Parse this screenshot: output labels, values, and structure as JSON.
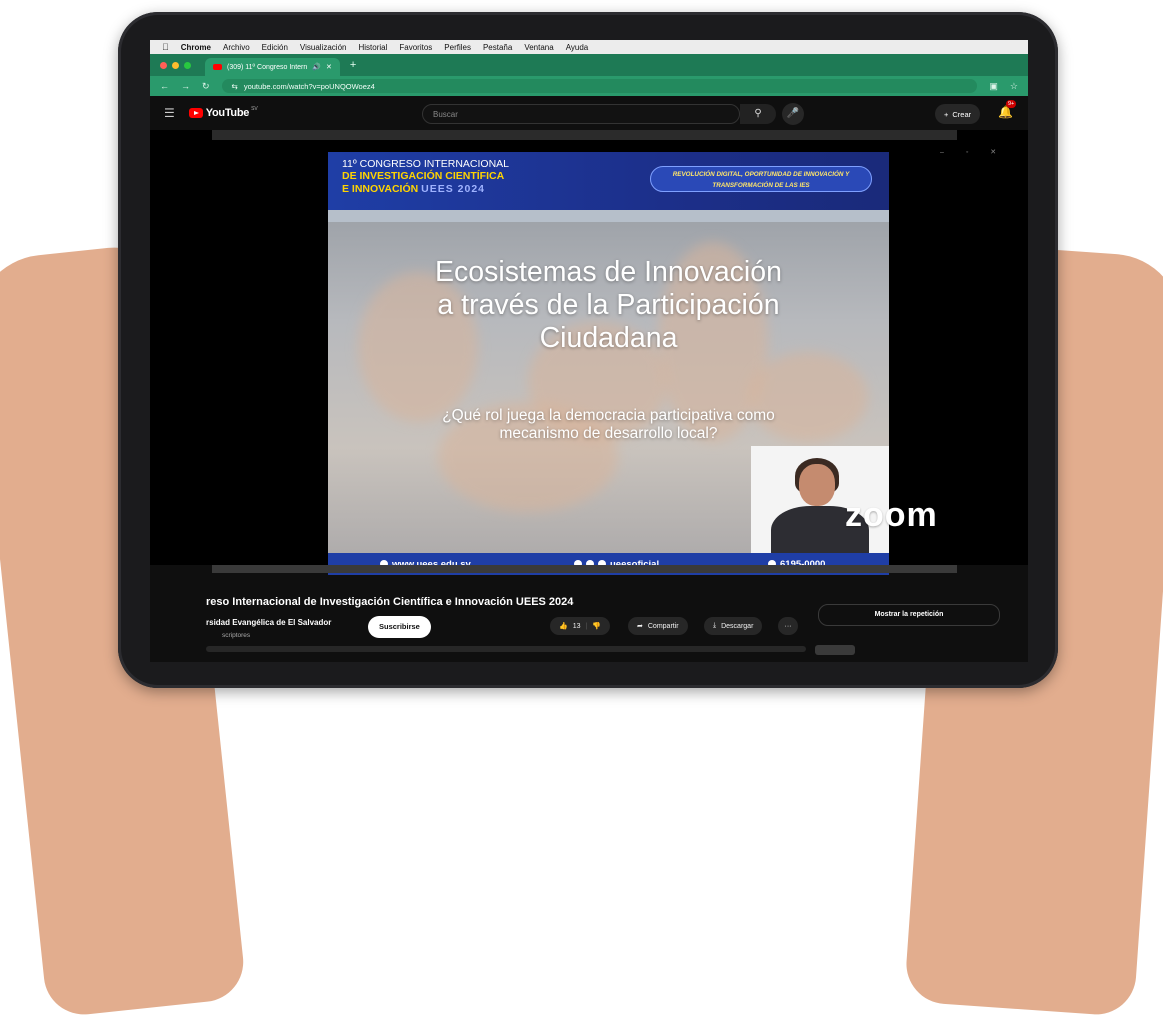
{
  "menubar": {
    "apple": "",
    "items": [
      "Chrome",
      "Archivo",
      "Edición",
      "Visualización",
      "Historial",
      "Favoritos",
      "Perfiles",
      "Pestaña",
      "Ventana",
      "Ayuda"
    ]
  },
  "browser": {
    "tab_title": "(309) 11º Congreso Intern",
    "new_tab": "+",
    "url": "youtube.com/watch?v=poUNQOWoez4"
  },
  "youtube": {
    "logo": "YouTube",
    "country": "SV",
    "search_placeholder": "Buscar",
    "create_label": "Crear",
    "notifications_badge": "9+"
  },
  "video": {
    "banner_line1": "11º CONGRESO INTERNACIONAL",
    "banner_line2": "DE INVESTIGACIÓN CIENTÍFICA",
    "banner_line3": "E INNOVACIÓN",
    "banner_line3_suffix": "UEES 2024",
    "banner_right": "REVOLUCIÓN DIGITAL, OPORTUNIDAD DE INNOVACIÓN Y TRANSFORMACIÓN DE LAS IES",
    "slide_title_1": "Ecosistemas de Innovación",
    "slide_title_2": "a través de la Participación",
    "slide_title_3": "Ciudadana",
    "slide_subtitle_1": "¿Qué rol juega la democracia participativa como",
    "slide_subtitle_2": "mecanismo de desarrollo local?",
    "footer_web": "www.uees.edu.sv",
    "footer_social": "ueesoficial",
    "footer_phone": "6195-0000",
    "zoom_watermark": "zoom"
  },
  "details": {
    "title": "reso Internacional de Investigación Científica e Innovación UEES 2024",
    "channel": "rsidad Evangélica de El Salvador",
    "subscribers": "scriptores",
    "subscribe_label": "Suscribirse",
    "likes": "13",
    "share_label": "Compartir",
    "download_label": "Descargar",
    "more_label": "···",
    "replay_label": "Mostrar la repetición"
  }
}
